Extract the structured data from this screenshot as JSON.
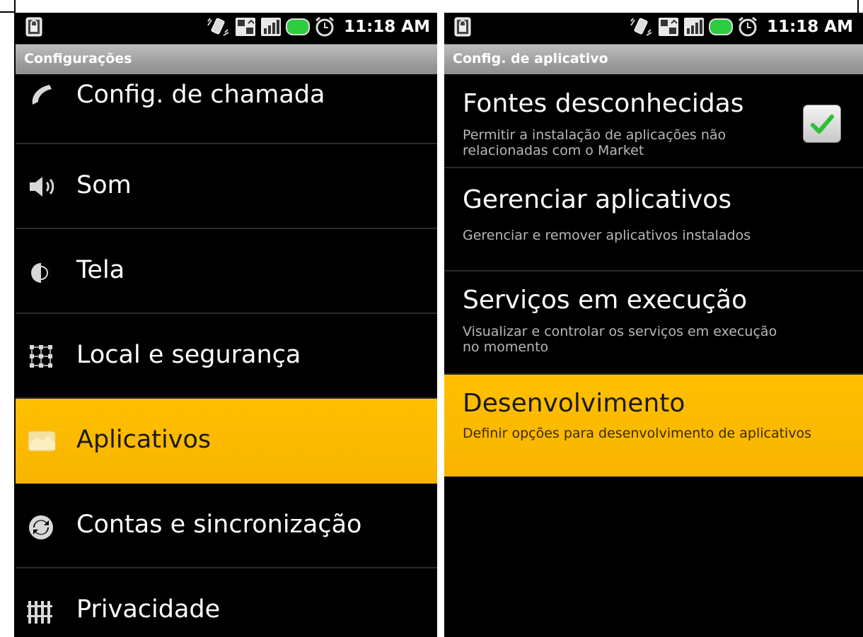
{
  "status_bar": {
    "time": "11:18 AM",
    "icons": [
      "lock-icon",
      "vibrate-icon",
      "sim-icon",
      "signal-icon",
      "battery-icon",
      "alarm-icon"
    ]
  },
  "left_screen": {
    "title": "Configurações",
    "items": [
      {
        "label": "Config. de chamada",
        "icon": "phone-icon",
        "selected": false
      },
      {
        "label": "Som",
        "icon": "speaker-icon",
        "selected": false
      },
      {
        "label": "Tela",
        "icon": "brightness-icon",
        "selected": false
      },
      {
        "label": "Local e segurança",
        "icon": "grid-icon",
        "selected": false
      },
      {
        "label": "Aplicativos",
        "icon": "apps-icon",
        "selected": true
      },
      {
        "label": "Contas e sincronização",
        "icon": "sync-icon",
        "selected": false
      },
      {
        "label": "Privacidade",
        "icon": "privacy-icon",
        "selected": false
      }
    ]
  },
  "right_screen": {
    "title": "Config. de aplicativo",
    "items": [
      {
        "title": "Fontes desconhecidas",
        "summary": "Permitir a instalação de aplicações não relacionadas com o Market",
        "checked": true,
        "selected": false
      },
      {
        "title": "Gerenciar aplicativos",
        "summary": "Gerenciar e remover aplicativos instalados",
        "selected": false
      },
      {
        "title": "Serviços em execução",
        "summary": "Visualizar e controlar os serviços em execução no momento",
        "selected": false
      },
      {
        "title": "Desenvolvimento",
        "summary": "Definir opções para desenvolvimento de aplicativos",
        "selected": true
      }
    ]
  },
  "colors": {
    "highlight": "#ffc000",
    "background": "#000000",
    "titlebar": "#a6a6a6",
    "check": "#2fbf3a"
  }
}
